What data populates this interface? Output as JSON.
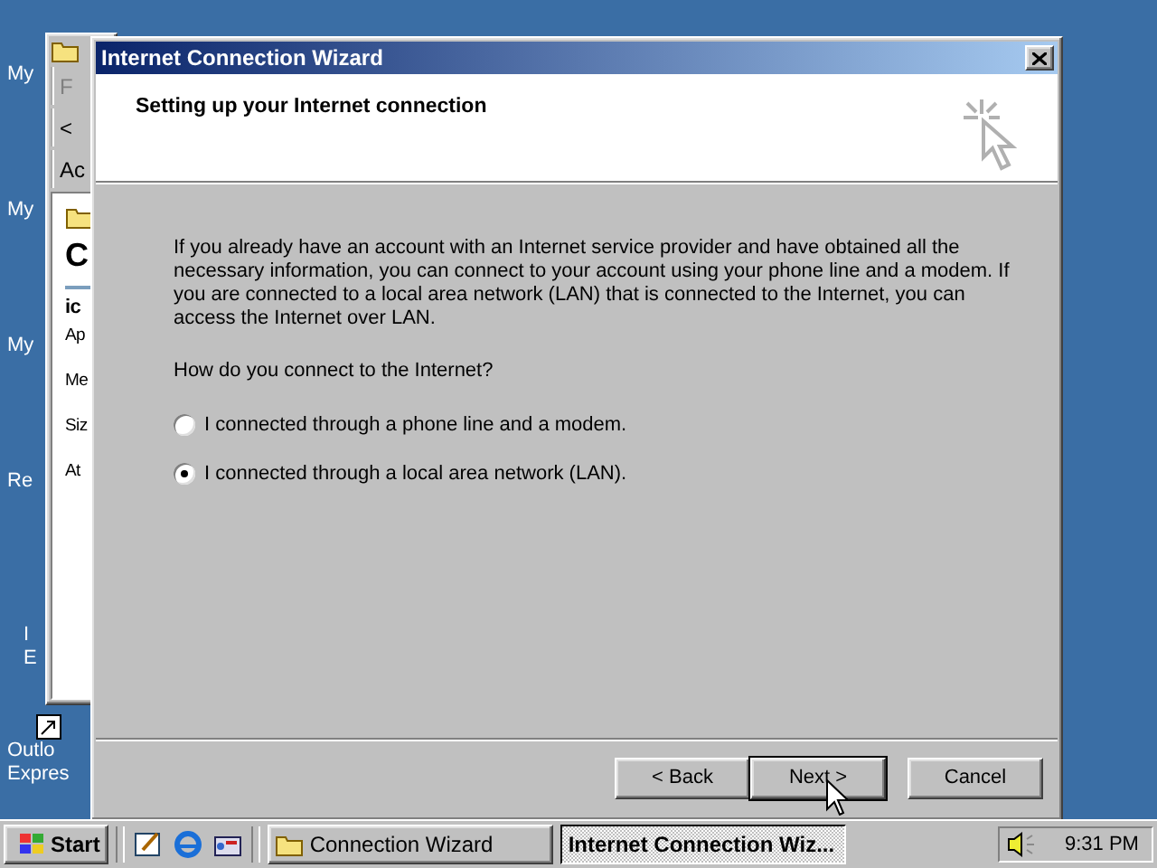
{
  "desktop_icons": [
    {
      "lines": [
        "My"
      ]
    },
    {
      "lines": [
        "My"
      ]
    },
    {
      "lines": [
        "My"
      ]
    },
    {
      "lines": [
        "Re"
      ]
    },
    {
      "lines": [
        "I",
        "E"
      ]
    },
    {
      "lines": [
        "Outlo",
        "Expres"
      ]
    }
  ],
  "background_window": {
    "toolbar": [
      "F",
      "<",
      "Ac"
    ],
    "heading": "C",
    "details": [
      "ic",
      "Ap",
      "Me",
      "Siz",
      "At"
    ]
  },
  "wizard": {
    "title": "Internet Connection Wizard",
    "header": "Setting up your Internet connection",
    "intro": "If you already have an account with an Internet service provider and have obtained all the necessary information, you can connect to your account using your phone line and a modem. If you are connected to a local area network (LAN) that is connected to the Internet, you can access the Internet over LAN.",
    "question": "How do you connect to the Internet?",
    "options": [
      {
        "label": "I connected through a phone line and a modem.",
        "selected": false
      },
      {
        "label": "I connected through a local area network (LAN).",
        "selected": true
      }
    ],
    "buttons": [
      {
        "label": "< Back",
        "default": false
      },
      {
        "label": "Next >",
        "default": true
      },
      {
        "label": "Cancel",
        "default": false
      }
    ]
  },
  "taskbar": {
    "start": "Start",
    "tasks": [
      {
        "label": "Connection Wizard",
        "selected": false
      },
      {
        "label": "Internet Connection Wiz...",
        "selected": true
      }
    ],
    "clock": "9:31 PM"
  }
}
